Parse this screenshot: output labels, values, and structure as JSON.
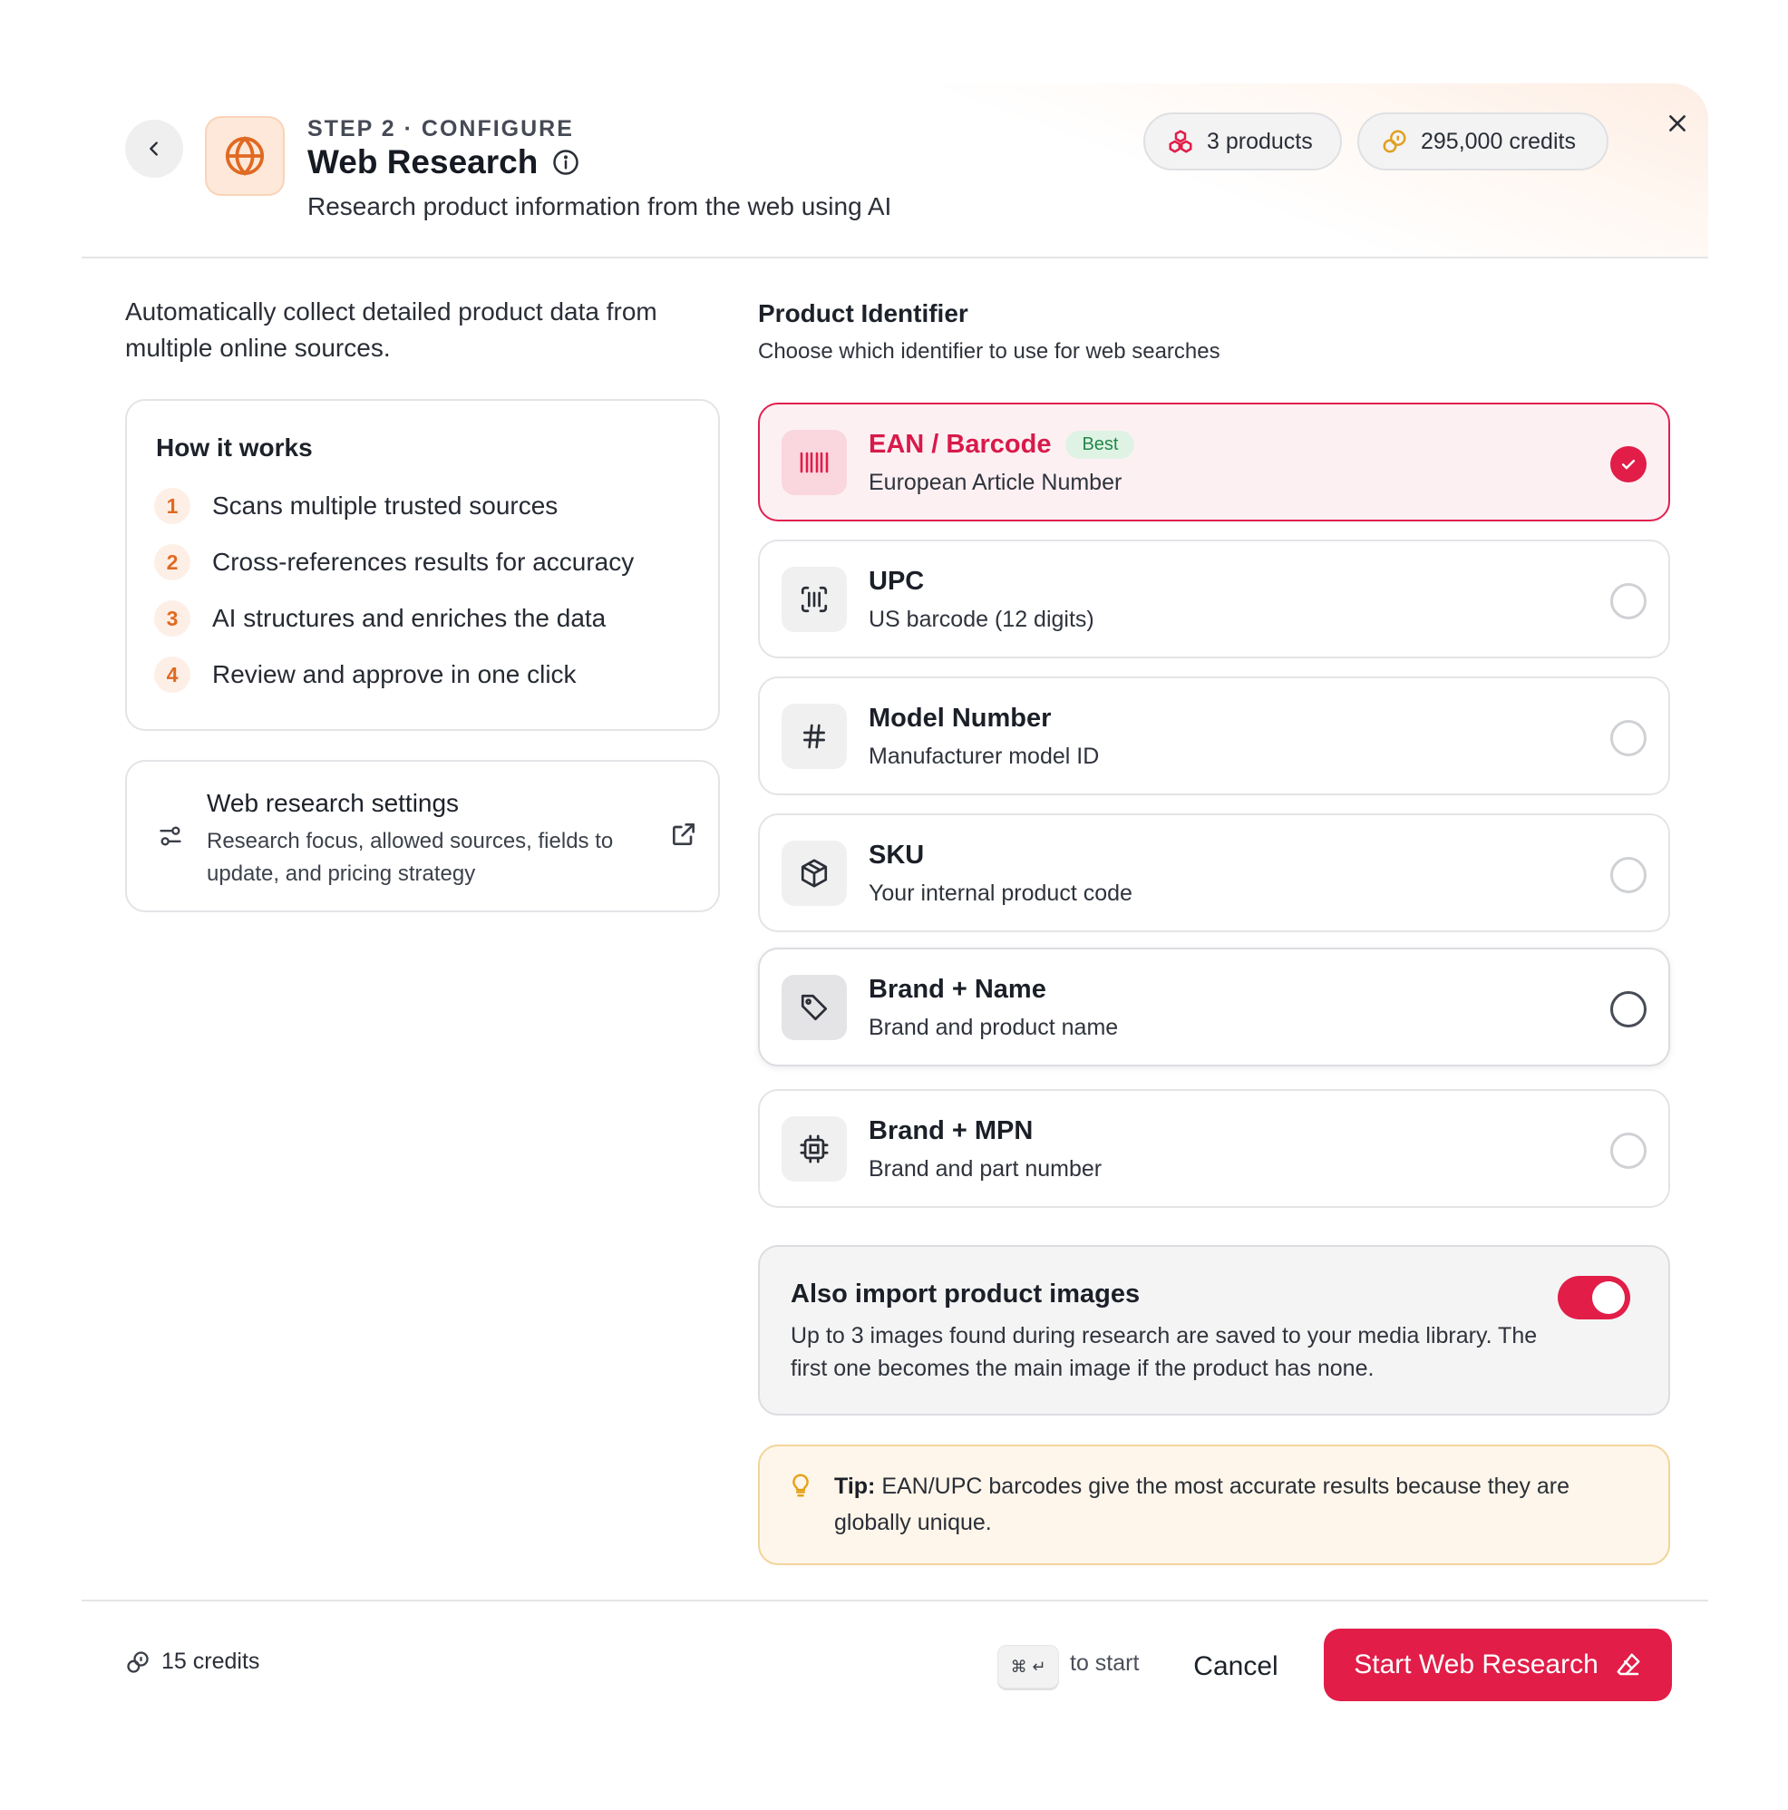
{
  "header": {
    "step_label": "STEP 2 · CONFIGURE",
    "title": "Web Research",
    "subtitle": "Research product information from the web using AI",
    "products_pill": "3 products",
    "credits_pill": "295,000 credits",
    "accent_color": "#e06a22"
  },
  "left": {
    "intro": "Automatically collect detailed product data from multiple online sources.",
    "how_it_works": {
      "title": "How it works",
      "steps": [
        {
          "num": "1",
          "label": "Scans multiple trusted sources"
        },
        {
          "num": "2",
          "label": "Cross-references results for accuracy"
        },
        {
          "num": "3",
          "label": "AI structures and enriches the data"
        },
        {
          "num": "4",
          "label": "Review and approve in one click"
        }
      ]
    },
    "settings": {
      "title": "Web research settings",
      "description": "Research focus, allowed sources, fields to update, and pricing strategy"
    }
  },
  "right": {
    "identifier_title": "Product Identifier",
    "identifier_subtitle": "Choose which identifier to use for web searches",
    "options": [
      {
        "name": "EAN / Barcode",
        "badge": "Best",
        "desc": "European Article Number",
        "icon": "barcode-icon",
        "selected": true
      },
      {
        "name": "UPC",
        "desc": "US barcode (12 digits)",
        "icon": "scan-barcode-icon",
        "selected": false
      },
      {
        "name": "Model Number",
        "desc": "Manufacturer model ID",
        "icon": "hash-icon",
        "selected": false
      },
      {
        "name": "SKU",
        "desc": "Your internal product code",
        "icon": "box-icon",
        "selected": false
      },
      {
        "name": "Brand + Name",
        "desc": "Brand and product name",
        "icon": "tag-icon",
        "selected": false
      },
      {
        "name": "Brand + MPN",
        "desc": "Brand and part number",
        "icon": "chip-icon",
        "selected": false
      }
    ],
    "images": {
      "title": "Also import product images",
      "description": "Up to 3 images found during research are saved to your media library. The first one becomes the main image if the product has none.",
      "enabled": true
    },
    "tip": {
      "label": "Tip:",
      "text": " EAN/UPC barcodes give the most accurate results because they are globally unique."
    }
  },
  "footer": {
    "credits": "15 credits",
    "shortcut": "⌘ ↵",
    "shortcut_label": "to start",
    "cancel_label": "Cancel",
    "start_label": "Start Web Research",
    "primary_color": "#e11d48"
  }
}
